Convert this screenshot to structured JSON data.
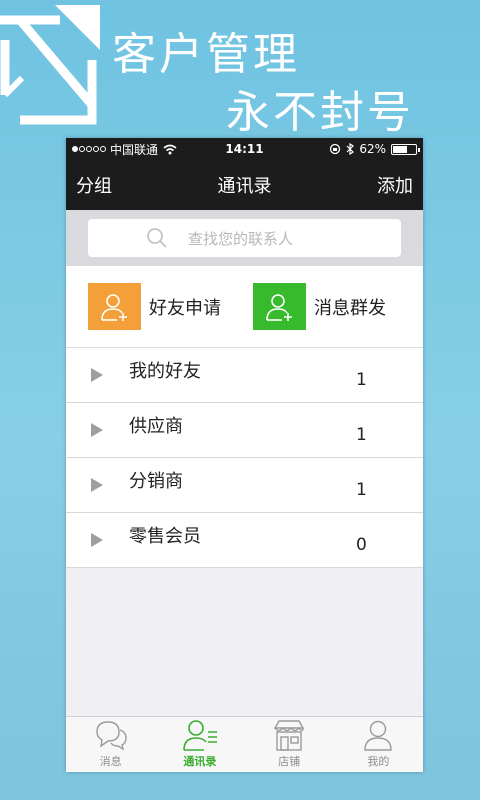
{
  "promo": {
    "line1": "客户管理",
    "line2": "永不封号",
    "logo_icon": "envelope-logo-icon"
  },
  "status_bar": {
    "signal_dots": "●○○○○",
    "carrier": "中国联通",
    "time": "14:11",
    "battery_text": "62%",
    "battery_level": 0.62
  },
  "nav": {
    "left": "分组",
    "title": "通讯录",
    "right": "添加"
  },
  "search": {
    "placeholder": "查找您的联系人"
  },
  "actions": [
    {
      "label": "好友申请",
      "icon": "add-user-icon",
      "color": "#f4a03a"
    },
    {
      "label": "消息群发",
      "icon": "add-user-icon",
      "color": "#37bb2c"
    }
  ],
  "groups": [
    {
      "name": "我的好友",
      "count": "1"
    },
    {
      "name": "供应商",
      "count": "1"
    },
    {
      "name": "分销商",
      "count": "1"
    },
    {
      "name": "零售会员",
      "count": "0"
    }
  ],
  "tabs": [
    {
      "label": "消息",
      "icon": "chat-bubble-icon",
      "active": false
    },
    {
      "label": "通讯录",
      "icon": "contacts-icon",
      "active": true
    },
    {
      "label": "店铺",
      "icon": "store-icon",
      "active": false
    },
    {
      "label": "我的",
      "icon": "person-icon",
      "active": false
    }
  ],
  "colors": {
    "accent_green": "#3aad2e",
    "nav_bg": "#1c1c1c",
    "background": "#7fc8e2"
  }
}
